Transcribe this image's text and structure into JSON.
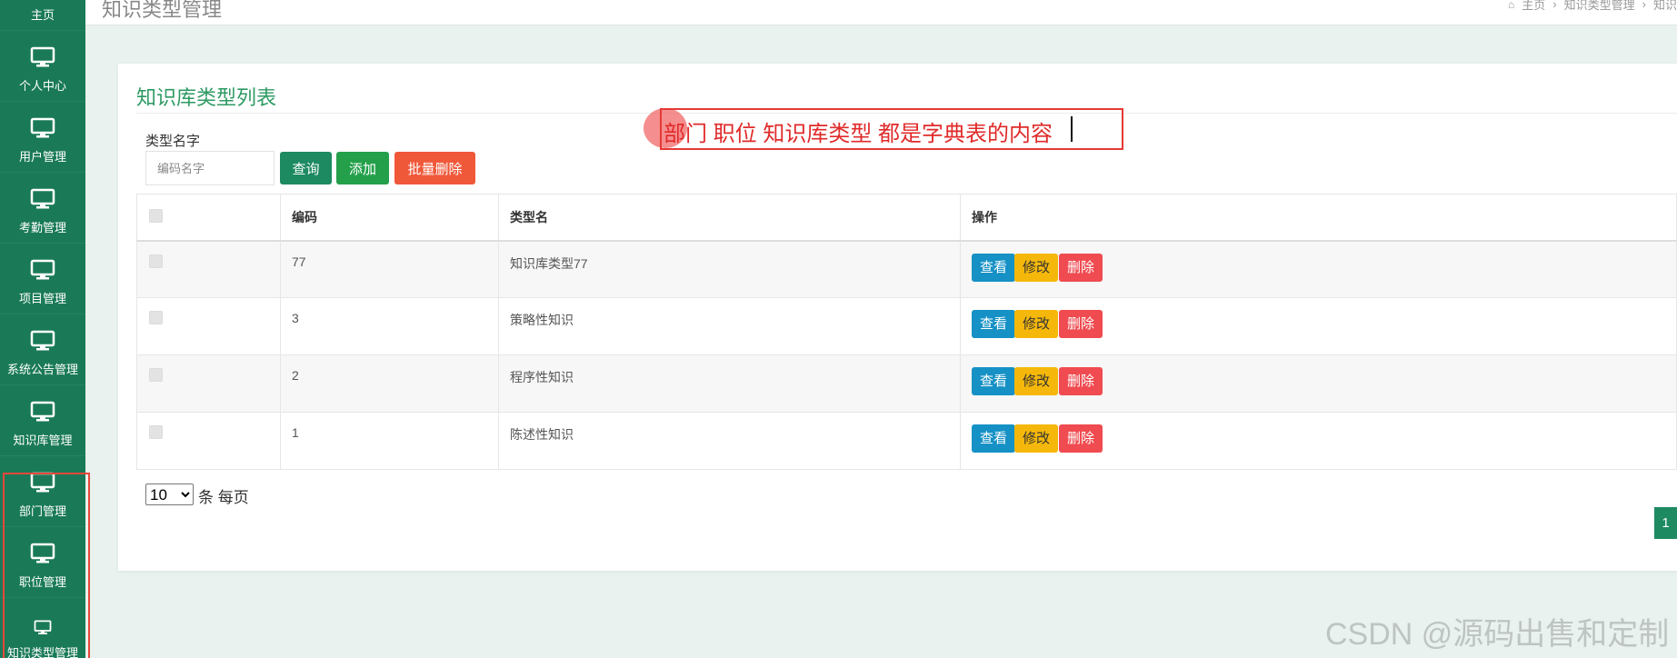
{
  "sidebar": {
    "items": [
      {
        "label": "主页",
        "icon": "home-icon"
      },
      {
        "label": "个人中心",
        "icon": "monitor-icon"
      },
      {
        "label": "用户管理",
        "icon": "monitor-icon"
      },
      {
        "label": "考勤管理",
        "icon": "monitor-icon"
      },
      {
        "label": "项目管理",
        "icon": "monitor-icon"
      },
      {
        "label": "系统公告管理",
        "icon": "monitor-icon"
      },
      {
        "label": "知识库管理",
        "icon": "monitor-icon"
      },
      {
        "label": "部门管理",
        "icon": "monitor-icon"
      },
      {
        "label": "职位管理",
        "icon": "monitor-icon"
      },
      {
        "label": "知识类型管理",
        "icon": "monitor-icon"
      }
    ],
    "accent_color": "#1a7a58"
  },
  "header": {
    "title": "知识类型管理",
    "breadcrumb": [
      "主页",
      "知识类型管理",
      "知识"
    ]
  },
  "panel": {
    "title": "知识库类型列表",
    "search": {
      "label": "类型名字",
      "placeholder": "编码名字",
      "value": ""
    },
    "buttons": {
      "query": "查询",
      "add": "添加",
      "batch_delete": "批量删除"
    }
  },
  "annotation": {
    "text": "部门   职位 知识库类型 都是字典表的内容"
  },
  "table": {
    "headers": {
      "id": "编码",
      "name": "类型名",
      "ops": "操作"
    },
    "rows": [
      {
        "id": "77",
        "name": "知识库类型77"
      },
      {
        "id": "3",
        "name": "策略性知识"
      },
      {
        "id": "2",
        "name": "程序性知识"
      },
      {
        "id": "1",
        "name": "陈述性知识"
      }
    ],
    "actions": {
      "view": "查看",
      "edit": "修改",
      "delete": "删除"
    }
  },
  "pagination": {
    "page_size": "10",
    "page_size_options": [
      "10"
    ],
    "suffix": "条 每页",
    "current_page": "1"
  },
  "watermark": "CSDN @源码出售和定制",
  "colors": {
    "primary": "#1d8a62",
    "add": "#24a04b",
    "danger": "#f0583a",
    "view": "#1691c5",
    "edit": "#f5b80a",
    "delete": "#ef4b50",
    "annotation": "#e02a2a"
  }
}
